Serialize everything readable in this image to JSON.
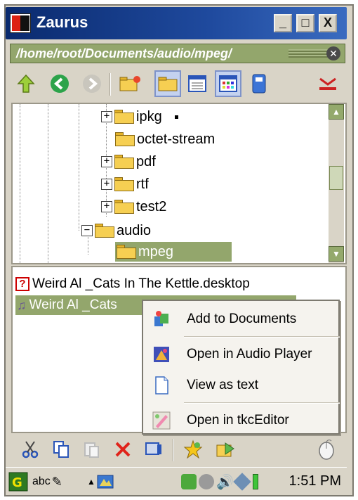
{
  "window": {
    "title": "Zaurus",
    "minimize": "_",
    "maximize": "□",
    "close": "X"
  },
  "pathbar": {
    "path": "/home/root/Documents/audio/mpeg/",
    "close": "✕"
  },
  "toolbar": {
    "icons": [
      "up-arrow-icon",
      "back-icon",
      "forward-icon",
      "new-folder-icon",
      "folder-view-icon",
      "detail-view-icon",
      "icon-view-icon",
      "disk-icon",
      "tool-icon"
    ]
  },
  "tree": {
    "items": [
      {
        "label": "ipkg",
        "expander": "+"
      },
      {
        "label": "octet-stream",
        "expander": ""
      },
      {
        "label": "pdf",
        "expander": "+"
      },
      {
        "label": "rtf",
        "expander": "+"
      },
      {
        "label": "test2",
        "expander": "+"
      },
      {
        "label": "audio",
        "expander": "−"
      },
      {
        "label": "mpeg",
        "expander": ""
      }
    ],
    "scroll_up": "▲",
    "scroll_down": "▼"
  },
  "files": [
    {
      "label": "Weird Al _Cats In The Kettle.desktop",
      "selected": false
    },
    {
      "label": "Weird Al _Cats",
      "selected": true
    }
  ],
  "context_menu": {
    "items": [
      {
        "label": "Add to Documents",
        "icon": "add-documents-icon"
      },
      {
        "label": "Open in Audio Player",
        "icon": "audio-player-icon"
      },
      {
        "label": "View as text",
        "icon": "text-doc-icon"
      },
      {
        "label": "Open in tkcEditor",
        "icon": "editor-icon"
      }
    ]
  },
  "bottom_toolbar": {
    "icons": [
      "cut-icon",
      "copy-icon",
      "paste-icon",
      "delete-icon",
      "properties-icon",
      "favorite-icon",
      "send-icon",
      "mouse-icon"
    ]
  },
  "taskbar": {
    "input_method": "abc",
    "clock": "1:51 PM"
  },
  "colors": {
    "selection": "#93a66c",
    "titlebar": "#0a2a6e"
  }
}
